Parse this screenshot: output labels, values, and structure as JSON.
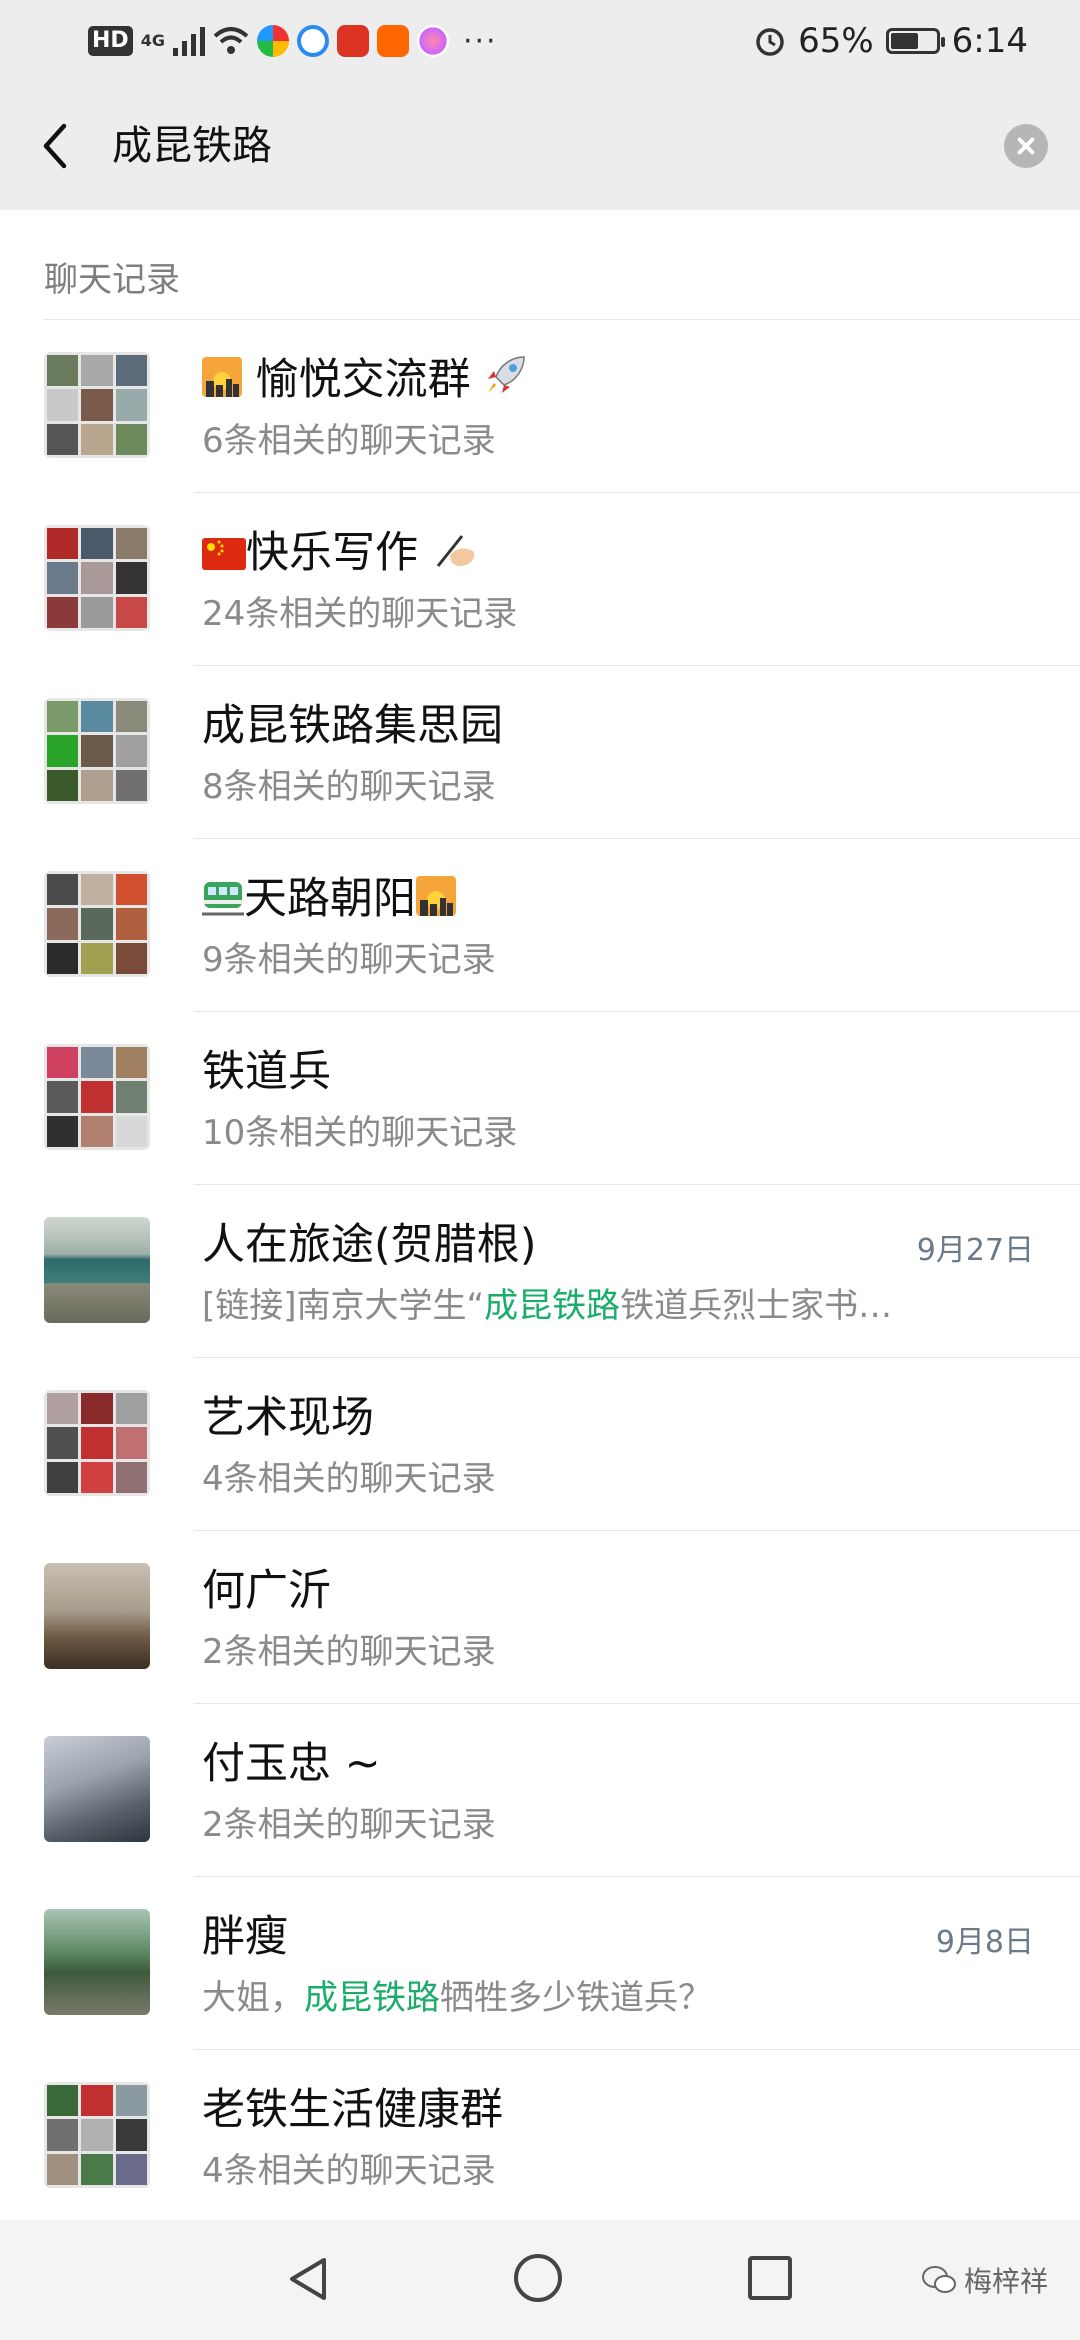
{
  "status_bar": {
    "network_badge": "HD",
    "network_type": "4G",
    "battery_percent": "65%",
    "battery_level": 0.65,
    "time": "6:14",
    "more": "···"
  },
  "search": {
    "query": "成昆铁路"
  },
  "section": {
    "title": "聊天记录"
  },
  "results": [
    {
      "name": "愉悦交流群",
      "sub": "6条相关的聊天记录",
      "date": ""
    },
    {
      "name": "快乐写作",
      "sub": "24条相关的聊天记录",
      "date": ""
    },
    {
      "name": "成昆铁路集思园",
      "sub": "8条相关的聊天记录",
      "date": ""
    },
    {
      "name": "天路朝阳",
      "sub": "9条相关的聊天记录",
      "date": ""
    },
    {
      "name": "铁道兵",
      "sub": "10条相关的聊天记录",
      "date": ""
    },
    {
      "name": "人在旅途(贺腊根)",
      "sub_pre": "[链接]南京大学生“",
      "sub_hl": "成昆铁路",
      "sub_post": "铁道兵烈士家书…",
      "date": "9月27日"
    },
    {
      "name": "艺术现场",
      "sub": "4条相关的聊天记录",
      "date": ""
    },
    {
      "name": "何广沂",
      "sub": "2条相关的聊天记录",
      "date": ""
    },
    {
      "name": "付玉忠 ~",
      "sub": "2条相关的聊天记录",
      "date": ""
    },
    {
      "name": "胖瘦",
      "sub_pre": "大姐，",
      "sub_hl": "成昆铁路",
      "sub_post": "牺牲多少铁道兵？",
      "date": "9月8日"
    },
    {
      "name": "老铁生活健康群",
      "sub": "4条相关的聊天记录",
      "date": ""
    }
  ],
  "watermark": "梅梓祥",
  "colors": {
    "header_bg": "#ededed",
    "highlight": "#1aad6a",
    "secondary_text": "#8a8a8a",
    "date_text": "#6b7a8a"
  },
  "icons": [
    "back-arrow-icon",
    "clear-icon",
    "nav-back-icon",
    "nav-home-icon",
    "nav-recent-icon",
    "wechat-icon",
    "alarm-icon",
    "wifi-icon",
    "signal-icon",
    "battery-icon"
  ]
}
